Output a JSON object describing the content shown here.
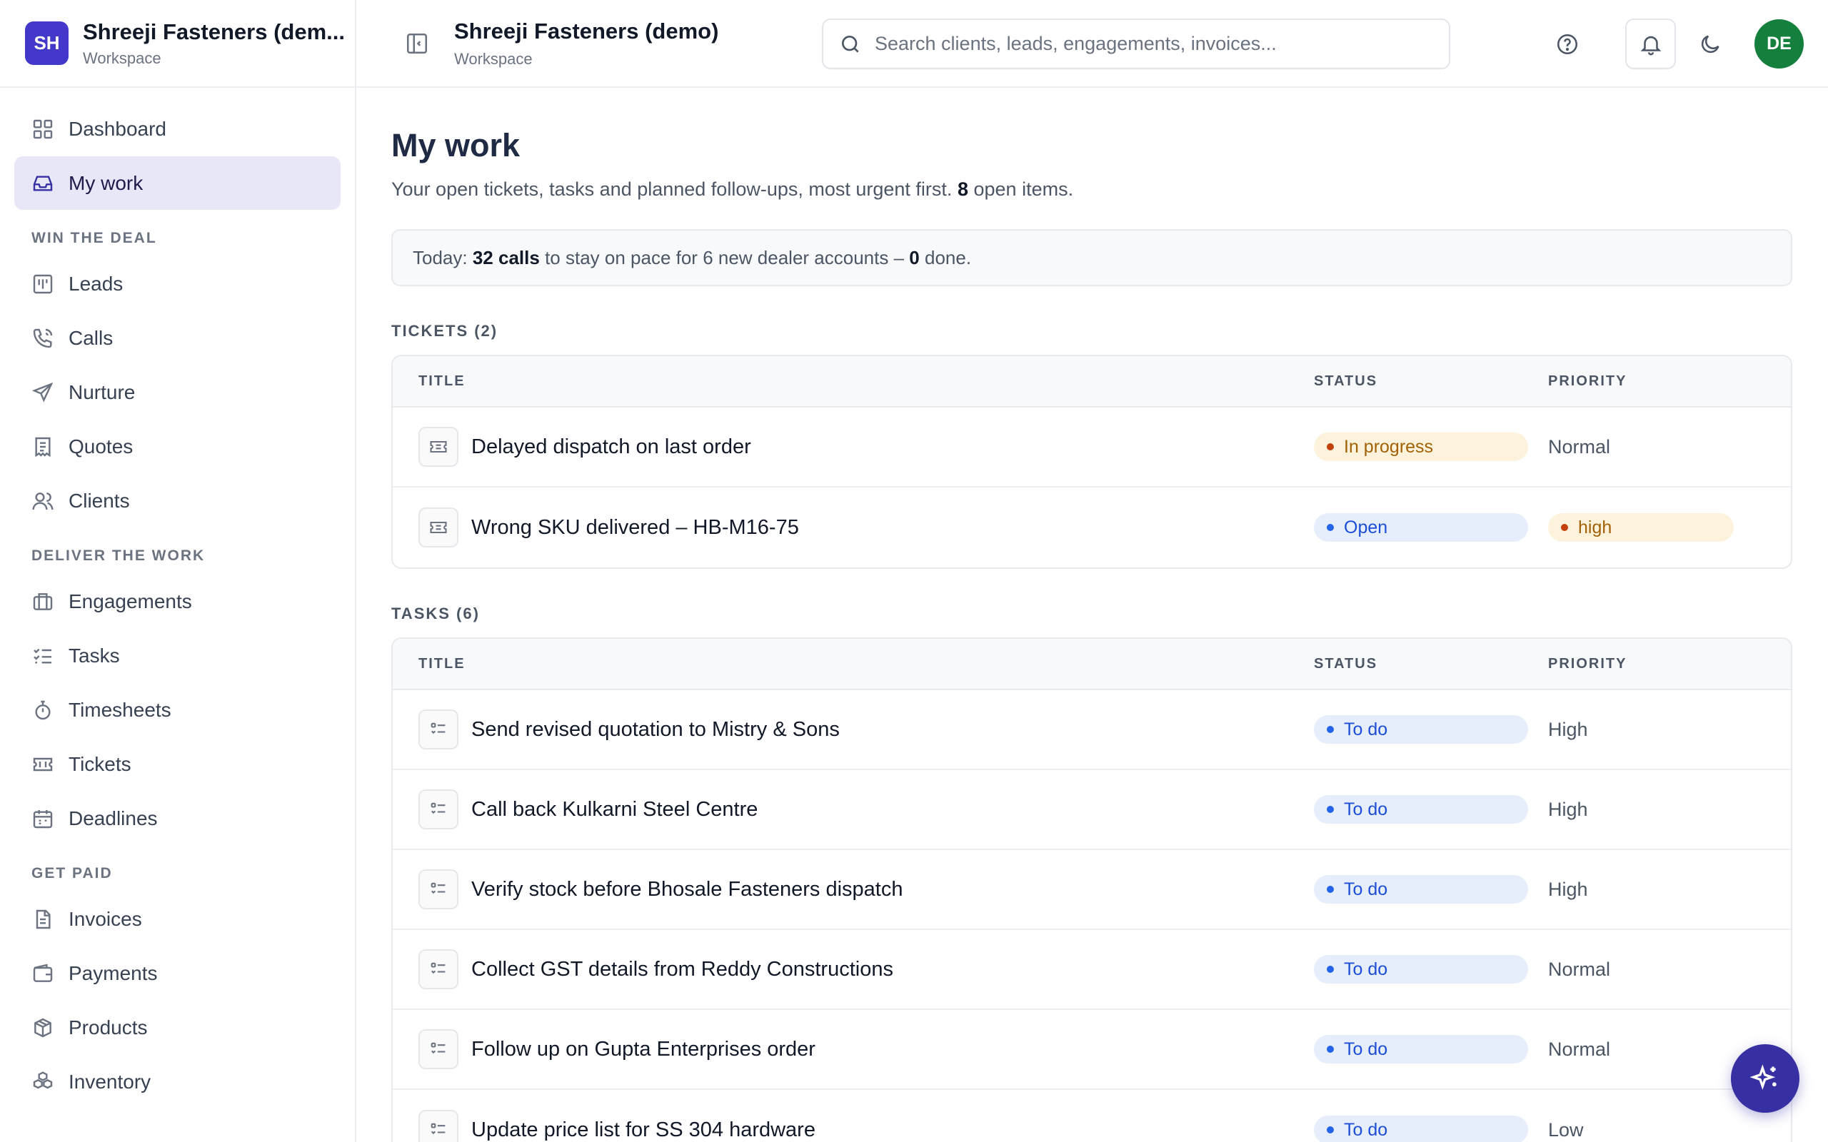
{
  "brand": {
    "initials": "SH",
    "name": "Shreeji Fasteners (dem...",
    "subtitle": "Workspace"
  },
  "header": {
    "title": "Shreeji Fasteners (demo)",
    "subtitle": "Workspace",
    "search_placeholder": "Search clients, leads, engagements, invoices...",
    "user_initials": "DE"
  },
  "sidebar": {
    "top_items": [
      {
        "label": "Dashboard",
        "icon": "grid-icon"
      },
      {
        "label": "My work",
        "icon": "inbox-icon",
        "active": true
      }
    ],
    "sections": [
      {
        "title": "WIN THE DEAL",
        "items": [
          {
            "label": "Leads",
            "icon": "kanban-icon"
          },
          {
            "label": "Calls",
            "icon": "phone-icon"
          },
          {
            "label": "Nurture",
            "icon": "send-icon"
          },
          {
            "label": "Quotes",
            "icon": "receipt-icon"
          },
          {
            "label": "Clients",
            "icon": "users-icon"
          }
        ]
      },
      {
        "title": "DELIVER THE WORK",
        "items": [
          {
            "label": "Engagements",
            "icon": "briefcase-icon"
          },
          {
            "label": "Tasks",
            "icon": "checklist-icon"
          },
          {
            "label": "Timesheets",
            "icon": "stopwatch-icon"
          },
          {
            "label": "Tickets",
            "icon": "ticket-icon"
          },
          {
            "label": "Deadlines",
            "icon": "calendar-icon"
          }
        ]
      },
      {
        "title": "GET PAID",
        "items": [
          {
            "label": "Invoices",
            "icon": "file-icon"
          },
          {
            "label": "Payments",
            "icon": "wallet-icon"
          },
          {
            "label": "Products",
            "icon": "package-icon"
          },
          {
            "label": "Inventory",
            "icon": "boxes-icon"
          }
        ]
      }
    ]
  },
  "main": {
    "title": "My work",
    "subtitle_prefix": "Your open tickets, tasks and planned follow-ups, most urgent first.",
    "open_count": "8",
    "subtitle_suffix": "open items.",
    "pace": {
      "prefix": "Today:",
      "calls": "32 calls",
      "middle": "to stay on pace for 6 new dealer accounts –",
      "done": "0",
      "suffix": "done."
    },
    "tickets": {
      "label": "TICKETS (2)",
      "columns": [
        "TITLE",
        "STATUS",
        "PRIORITY"
      ],
      "rows": [
        {
          "title": "Delayed dispatch on last order",
          "status": "In progress",
          "priority": "Normal"
        },
        {
          "title": "Wrong SKU delivered – HB-M16-75",
          "status": "Open",
          "priority": "high"
        }
      ]
    },
    "tasks": {
      "label": "TASKS (6)",
      "columns": [
        "TITLE",
        "STATUS",
        "PRIORITY"
      ],
      "rows": [
        {
          "title": "Send revised quotation to Mistry & Sons",
          "status": "To do",
          "priority": "High"
        },
        {
          "title": "Call back Kulkarni Steel Centre",
          "status": "To do",
          "priority": "High"
        },
        {
          "title": "Verify stock before Bhosale Fasteners dispatch",
          "status": "To do",
          "priority": "High"
        },
        {
          "title": "Collect GST details from Reddy Constructions",
          "status": "To do",
          "priority": "Normal"
        },
        {
          "title": "Follow up on Gupta Enterprises order",
          "status": "To do",
          "priority": "Normal"
        },
        {
          "title": "Update price list for SS 304 hardware",
          "status": "To do",
          "priority": "Low"
        }
      ]
    }
  },
  "colors": {
    "brand": "#4338ca",
    "active_nav": "#e8e7f7",
    "avatar": "#15803d",
    "fab": "#3730a3"
  }
}
